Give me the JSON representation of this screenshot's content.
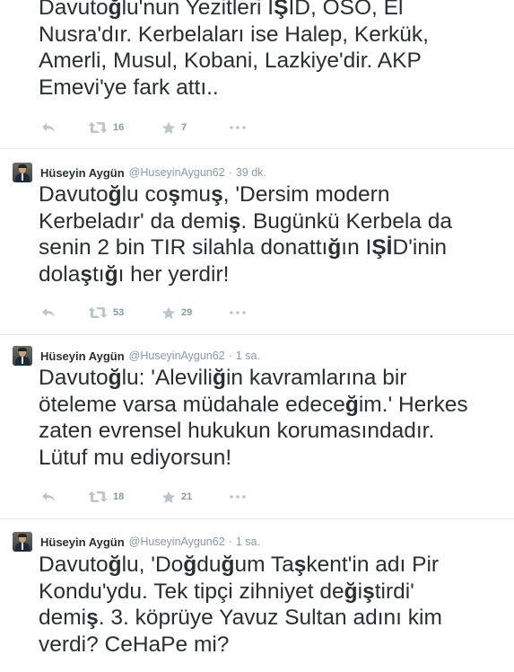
{
  "tweets": [
    {
      "text_html": "Davuto<b>ğ</b>lu'nun Yezitleri I<b>Ş</b>ID, OSO, El\nNusra'dır. Kerbelaları ise Halep, Kerkük,\nAmerli, Musul, Kobani, Lazkiye'dir. AKP\nEmevi'ye fark attı..",
      "retweets": "16",
      "favorites": "7"
    },
    {
      "name": "Hüseyin Aygün",
      "handle": "@HuseyinAygun62",
      "time": "39 dk.",
      "text_html": "Davuto<b>ğ</b>lu co<b>ş</b>mu<b>ş</b>, 'Dersim modern\nKerbeladır' da demi<b>ş</b>. Bugünkü Kerbela da\nsenin 2 bin TIR silahla donattı<b>ğ</b>ın I<b>Şİ</b>D'inin\ndola<b>ş</b>tı<b>ğ</b>ı her yerdir!",
      "retweets": "53",
      "favorites": "29"
    },
    {
      "name": "Hüseyin Aygün",
      "handle": "@HuseyinAygun62",
      "time": "1 sa.",
      "text_html": "Davuto<b>ğ</b>lu: 'Alevili<b>ğ</b>in kavramlarına bir\nöteleme varsa müdahale edece<b>ğ</b>im.' Herkes\nzaten evrensel hukukun korumasındadır.\nLütuf mu ediyorsun!",
      "retweets": "18",
      "favorites": "21"
    },
    {
      "name": "Hüseyin Aygün",
      "handle": "@HuseyinAygun62",
      "time": "1 sa.",
      "text_html": "Davuto<b>ğ</b>lu, 'Do<b>ğ</b>du<b>ğ</b>um Ta<b>ş</b>kent'in adı Pir\nKondu'ydu. Tek tipçi zihniyet de<b>ğ</b>i<b>ş</b>tirdi'\ndemi<b>ş</b>. 3. köprüye Yavuz Sultan adını kim\nverdi? CeHaPe mi?"
    }
  ],
  "separator": "·",
  "colors": {
    "text": "#292f33",
    "meta": "#8899a6",
    "icon": "#bcc5cc",
    "divider": "#e1e8ed"
  },
  "icons": [
    "reply-icon",
    "retweet-icon",
    "favorite-star-icon",
    "more-dots-icon"
  ]
}
